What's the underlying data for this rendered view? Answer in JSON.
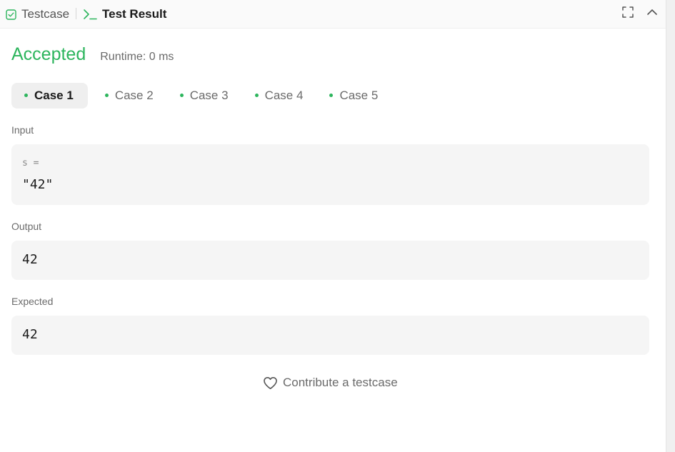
{
  "tabs": {
    "testcase_label": "Testcase",
    "result_label": "Test Result"
  },
  "result": {
    "status": "Accepted",
    "runtime": "Runtime: 0 ms"
  },
  "cases": [
    {
      "label": "Case 1",
      "active": true
    },
    {
      "label": "Case 2",
      "active": false
    },
    {
      "label": "Case 3",
      "active": false
    },
    {
      "label": "Case 4",
      "active": false
    },
    {
      "label": "Case 5",
      "active": false
    }
  ],
  "input": {
    "label": "Input",
    "var_name": "s =",
    "value": "\"42\""
  },
  "output": {
    "label": "Output",
    "value": "42"
  },
  "expected": {
    "label": "Expected",
    "value": "42"
  },
  "footer": {
    "contribute_label": "Contribute a testcase"
  },
  "colors": {
    "accent_green": "#2db55d"
  },
  "icons": {
    "testcase": "checkbox-icon",
    "result": "terminal-prompt-icon",
    "expand": "fullscreen-icon",
    "collapse": "chevron-up-icon",
    "contribute": "heart-icon"
  }
}
